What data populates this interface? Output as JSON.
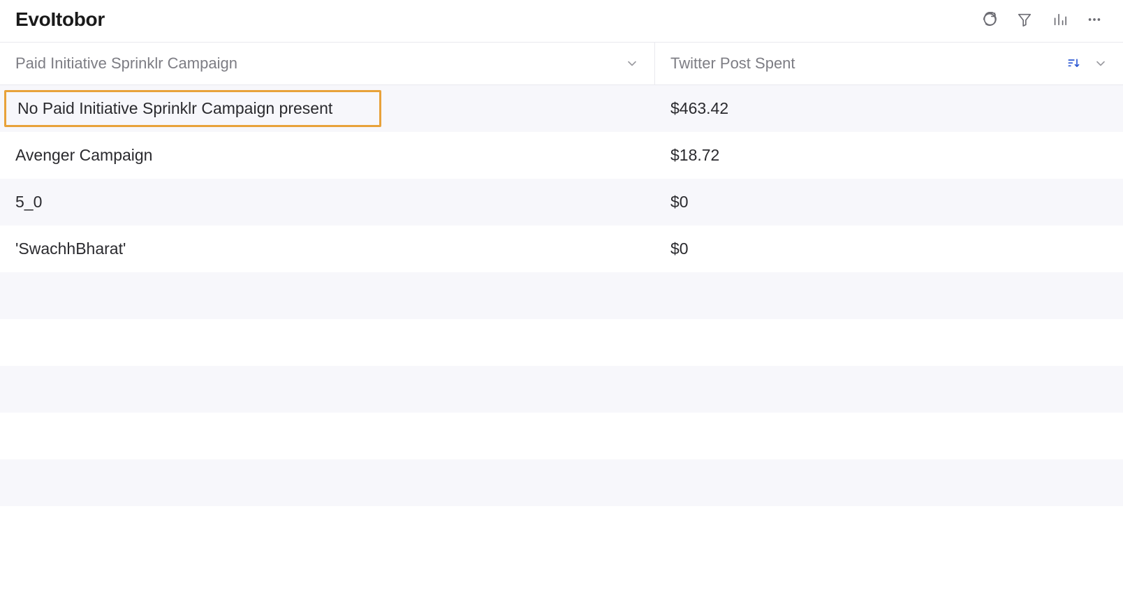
{
  "header": {
    "title": "EvoItobor"
  },
  "columns": {
    "left": {
      "label": "Paid Initiative Sprinklr Campaign"
    },
    "right": {
      "label": "Twitter Post Spent"
    }
  },
  "rows": [
    {
      "campaign": "No Paid Initiative Sprinklr Campaign present",
      "spent": "$463.42",
      "highlight": true
    },
    {
      "campaign": "Avenger Campaign",
      "spent": "$18.72"
    },
    {
      "campaign": "5_0",
      "spent": "$0"
    },
    {
      "campaign": "'SwachhBharat'",
      "spent": "$0"
    }
  ]
}
